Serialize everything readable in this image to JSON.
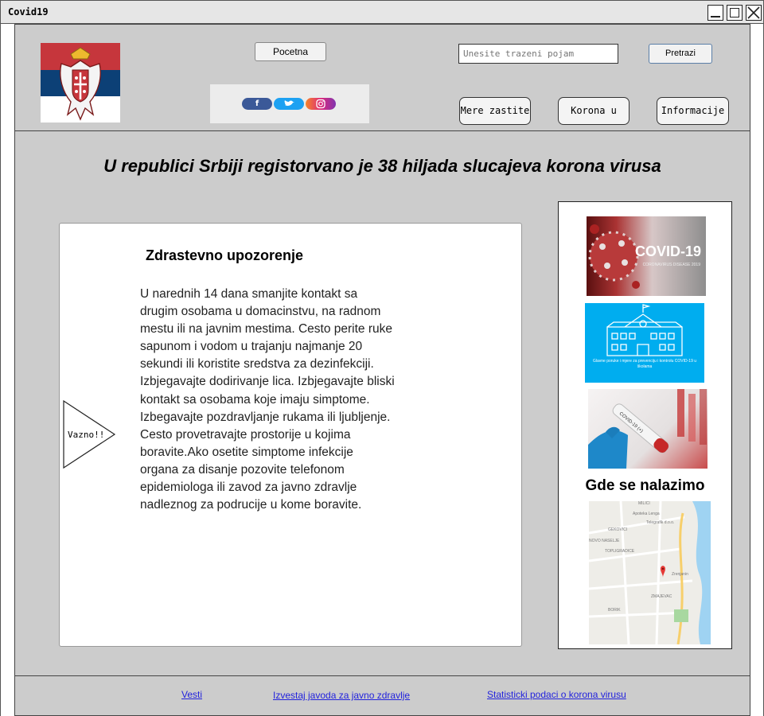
{
  "window": {
    "title": "Covid19"
  },
  "header": {
    "home_button": "Pocetna",
    "search": {
      "placeholder": "Unesite trazeni pojam",
      "button": "Pretrazi"
    },
    "social": {
      "facebook": "f",
      "twitter": "t",
      "instagram": "instagram-icon"
    },
    "tabs": [
      {
        "label": "Mere zastite"
      },
      {
        "label": "Korona u svetu"
      },
      {
        "label": "Informacije"
      }
    ]
  },
  "main": {
    "headline": "U republici Srbiji registorvano je 38 hiljada slucajeva korona virusa",
    "notice": {
      "title": "Zdrastevno upozorenje",
      "body": "U narednih 14 dana smanjite kontakt sa drugim osobama u domacinstvu, na radnom mestu ili na javnim mestima. Cesto perite ruke sapunom i vodom u trajanju najmanje 20 sekundi ili koristite sredstva za dezinfekciji. Izbjegavajte dodirivanje lica. Izbjegavajte bliski kontakt sa osobama koje imaju simptome. Izbegavajte pozdravljanje rukama ili ljubljenje. Cesto provetravajte prostorije u kojima boravite.Ako osetite simptome infekcije organa za disanje pozovite telefonom epidemiologa ili zavod za javno zdravlje nadleznog za podrucije u kome boravite.",
      "badge": "Vazno!!"
    },
    "sidebar": {
      "covid_banner": {
        "title": "COVID-19",
        "subtitle": "CORONAVIRUS DISEASE 2019"
      },
      "school_banner": {
        "caption": "Glavne poruke i mjere za prevenciju i kontrolu COVID-19 u školama"
      },
      "location_title": "Gde se nalazimo",
      "map_labels": [
        "MILICI",
        "Apoteka Lenga",
        "Telegrafik d.o.o.",
        "GEKOVICI",
        "NOVO NASELJE",
        "TOPLIGRADICE",
        "ZMAJEVAC",
        "BORIK",
        "Zrenjanin"
      ]
    }
  },
  "footer": {
    "links": [
      {
        "label": "Vesti"
      },
      {
        "label": "Izvestaj javoda za javno zdravlje"
      },
      {
        "label": "Statisticki podaci o korona virusu"
      }
    ]
  },
  "colors": {
    "panel_bg": "#cccccc",
    "flag_red": "#c6363c",
    "flag_blue": "#0c4076",
    "school_blue": "#00adef",
    "link": "#2222dd"
  }
}
